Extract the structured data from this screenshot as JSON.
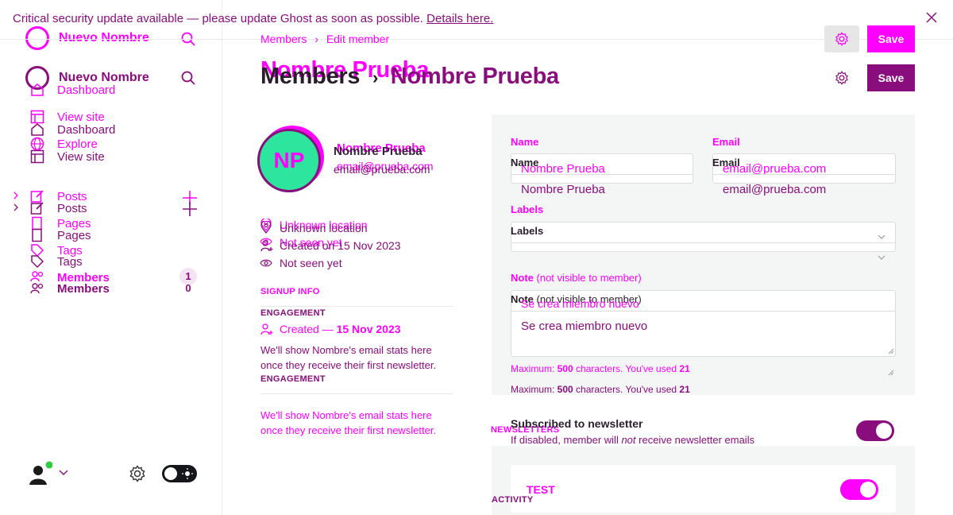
{
  "banner": {
    "message": "Critical security update available — please update Ghost as soon as possible.",
    "link": "Details here."
  },
  "sidebar": {
    "site_name": "Nuevo Nombre",
    "items": {
      "dashboard": "Dashboard",
      "view_site": "View site",
      "explore": "Explore",
      "posts": "Posts",
      "pages": "Pages",
      "tags": "Tags",
      "members": "Members"
    },
    "members_count_ghost": "1",
    "members_count": "0",
    "theme": "dark-mode-toggle"
  },
  "breadcrumb": {
    "parent": "Members",
    "current": "Edit member"
  },
  "page_title": {
    "ghost": "Nombre Prueba",
    "parent": "Members",
    "current": "Nombre Prueba"
  },
  "toolbar": {
    "save_label": "Save"
  },
  "member": {
    "initials": "NP",
    "name": "Nombre Prueba",
    "email": "email@prueba.com",
    "location": "Unknown location",
    "created": "Created on 15 Nov 2023",
    "not_seen": "Not seen yet",
    "activity_created_prefix": "Created — ",
    "activity_created_date": "15 Nov 2023",
    "engagement_text": "We'll show Nombre's email stats here once they receive their first newsletter."
  },
  "sections": {
    "signup_info": "SIGNUP INFO",
    "engagement": "ENGAGEMENT",
    "newsletters": "NEWSLETTERS",
    "activity": "ACTIVITY"
  },
  "form": {
    "name_label": "Name",
    "name_value": "Nombre Prueba",
    "email_label": "Email",
    "email_value": "email@prueba.com",
    "labels_label": "Labels",
    "note_label": "Note",
    "note_sub": " (not visible to member)",
    "note_value": "Se crea miembro nuevo",
    "max_prefix": "Maximum: ",
    "max_num": "500",
    "max_mid": " characters. You've used ",
    "max_used": "21"
  },
  "newsletter": {
    "subscribed_label": "Subscribed to newsletter",
    "subscribed_hint_a": "If disabled, member will ",
    "subscribed_hint_em": "not",
    "subscribed_hint_b": " receive newsletter emails",
    "subscribed_on": true,
    "newsletter_name": "TEST",
    "newsletter_on": true
  },
  "colors": {
    "accent_magenta": "#ff00ff",
    "accent_purple": "#8a0d7d",
    "avatar_green": "#2ee59d",
    "status_online": "#2ecc40"
  }
}
